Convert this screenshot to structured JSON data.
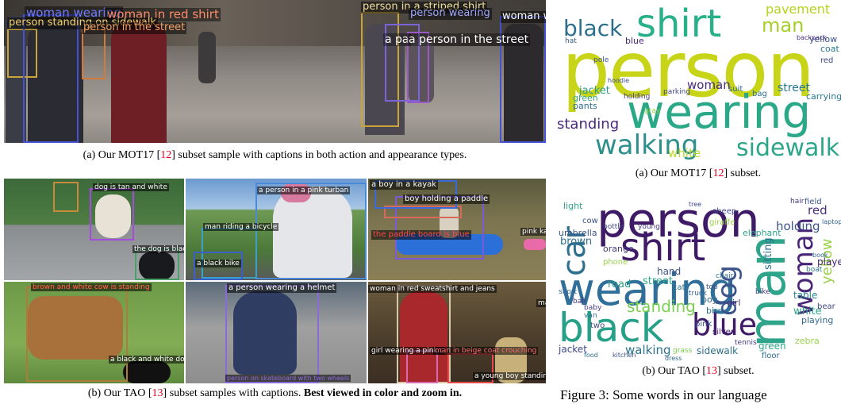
{
  "mot_panel": {
    "caption_prefix": "(a) Our MOT17 [",
    "caption_ref": "12",
    "caption_suffix": "] subset sample with captions in both action and appearance types.",
    "labels": [
      "woman wearing",
      "woman in red shirt",
      "person standing on sidewalk",
      "person in the street",
      "person in a striped shirt",
      "person wearing",
      "woman w",
      "a pa",
      "a person in the street"
    ]
  },
  "tao_panel": {
    "caption_prefix": "(b) Our TAO [",
    "caption_ref": "13",
    "caption_mid": "] subset samples with captions. ",
    "caption_bold": "Best viewed in color and zoom in.",
    "frames": [
      {
        "labels": [
          "dog is tan and white",
          "the dog is black"
        ]
      },
      {
        "labels": [
          "a person in a pink turban",
          "man riding a bicycle",
          "a black bike"
        ]
      },
      {
        "labels": [
          "a boy in a kayak",
          "boy holding a paddle",
          "the paddle board is blue",
          "pink kay"
        ]
      },
      {
        "labels": [
          "brown and white cow is standing",
          "a black and white dog"
        ]
      },
      {
        "labels": [
          "a person wearing a helmet",
          "person on skateboard with two wheels"
        ]
      },
      {
        "labels": [
          "woman in red sweatshirt and jeans",
          "girl wearing a pink c",
          "man in beige coat crouching",
          "a young boy standing",
          "ma"
        ]
      }
    ]
  },
  "wordclouds": {
    "mot": {
      "caption_prefix": "(a) Our MOT17 [",
      "caption_ref": "12",
      "caption_suffix": "] subset.",
      "words": [
        "person",
        "wearing",
        "shirt",
        "walking",
        "sidewalk",
        "black",
        "man",
        "pavement",
        "standing",
        "white",
        "woman",
        "street",
        "jacket",
        "blue",
        "green",
        "pants",
        "yellow",
        "coat",
        "red",
        "bag",
        "pole",
        "hat",
        "backpack",
        "carrying",
        "holding",
        "suit",
        "hoodie",
        "parking",
        "gray"
      ]
    },
    "tao": {
      "caption_prefix": "(b) Our TAO [",
      "caption_ref": "13",
      "caption_suffix": "] subset.",
      "words": [
        "person",
        "wearing",
        "man",
        "shirt",
        "black",
        "blue",
        "car",
        "woman",
        "standing",
        "holding",
        "dog",
        "yellow",
        "red",
        "brown",
        "white",
        "sitting",
        "walking",
        "street",
        "table",
        "player",
        "green",
        "jacket",
        "road",
        "boy",
        "girl",
        "cow",
        "bird",
        "umbrella",
        "sheep",
        "giraffe",
        "elephant",
        "orange",
        "hand",
        "zebra",
        "playing",
        "sidewalk",
        "bear",
        "silver",
        "light",
        "field",
        "hair",
        "laptop",
        "book",
        "phone",
        "boat",
        "tree",
        "bike",
        "cat",
        "pink",
        "floor",
        "grass",
        "short",
        "bottle",
        "young",
        "truck",
        "kitchen",
        "food",
        "dress",
        "baby",
        "van",
        "tennis",
        "top",
        "chair",
        "two",
        "ball"
      ]
    }
  },
  "figure_caption": "Figure 3: Some words in our language"
}
